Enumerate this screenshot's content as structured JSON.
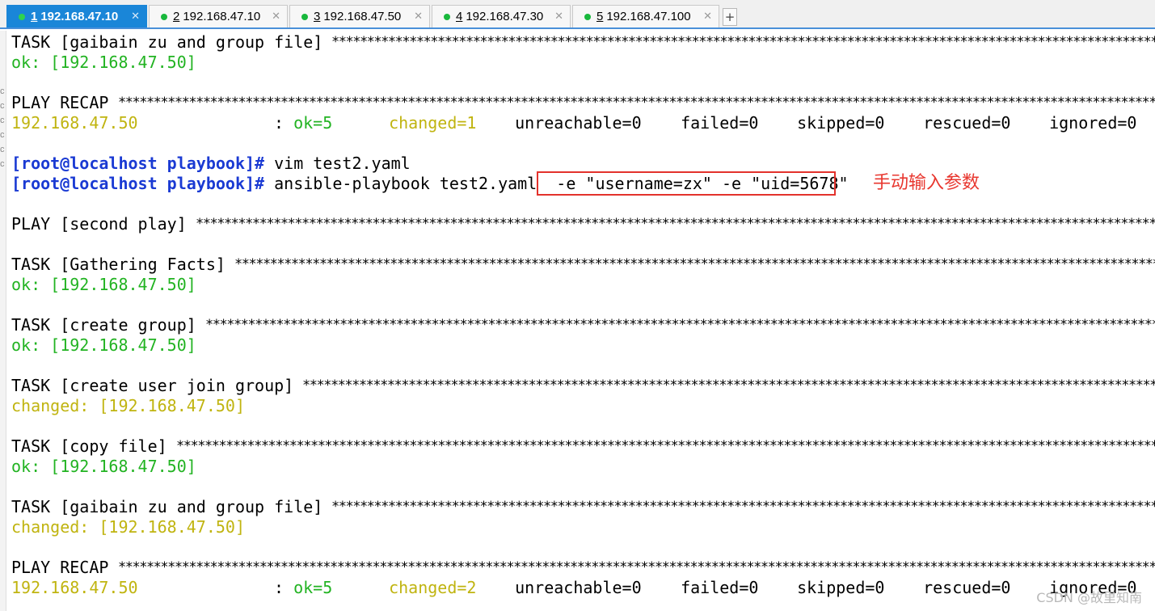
{
  "tabs": [
    {
      "num": "1",
      "label": " 192.168.47.10",
      "active": true
    },
    {
      "num": "2",
      "label": " 192.168.47.10",
      "active": false
    },
    {
      "num": "3",
      "label": " 192.168.47.50",
      "active": false
    },
    {
      "num": "4",
      "label": " 192.168.47.30",
      "active": false
    },
    {
      "num": "5",
      "label": " 192.168.47.100",
      "active": false
    }
  ],
  "new_tab_label": "+",
  "close_glyph": "✕",
  "colors": {
    "accent": "#1a86d8",
    "ok": "#22b322",
    "changed": "#c0b410",
    "prompt": "#1a3ad3",
    "highlight": "#e3322c"
  },
  "stars": "*****************************************************************************************************************************************************",
  "terminal": {
    "l1_head": "TASK [gaibain zu and group file] ",
    "l2_ok": "ok: [192.168.47.50]",
    "l4_head": "PLAY RECAP ",
    "recap1": {
      "host": "192.168.47.50",
      "sep": ": ",
      "ok": "ok=5",
      "changed": "changed=1",
      "unreachable": "unreachable=0",
      "failed": "failed=0",
      "skipped": "skipped=0",
      "rescued": "rescued=0",
      "ignored": "ignored=0"
    },
    "prompt1": "[root@localhost playbook]#",
    "cmd1": " vim test2.yaml",
    "prompt2": "[root@localhost playbook]#",
    "cmd2": " ansible-playbook test2.yaml  -e \"username=zx\" -e \"uid=5678\"",
    "play_head": "PLAY [second play] ",
    "t1_head": "TASK [Gathering Facts] ",
    "t1_res": "ok: [192.168.47.50]",
    "t2_head": "TASK [create group] ",
    "t2_res": "ok: [192.168.47.50]",
    "t3_head": "TASK [create user join group] ",
    "t3_res": "changed: [192.168.47.50]",
    "t4_head": "TASK [copy file] ",
    "t4_res": "ok: [192.168.47.50]",
    "t5_head": "TASK [gaibain zu and group file] ",
    "t5_res": "changed: [192.168.47.50]",
    "recap_head2": "PLAY RECAP ",
    "recap2": {
      "host": "192.168.47.50",
      "sep": ": ",
      "ok": "ok=5",
      "changed": "changed=2",
      "unreachable": "unreachable=0",
      "failed": "failed=0",
      "skipped": "skipped=0",
      "rescued": "rescued=0",
      "ignored": "ignored=0"
    }
  },
  "annotation": "手动输入参数",
  "watermark": "CSDN @故里知南",
  "edge_marks": [
    "c",
    "c",
    "c",
    "c",
    "c",
    "c"
  ]
}
